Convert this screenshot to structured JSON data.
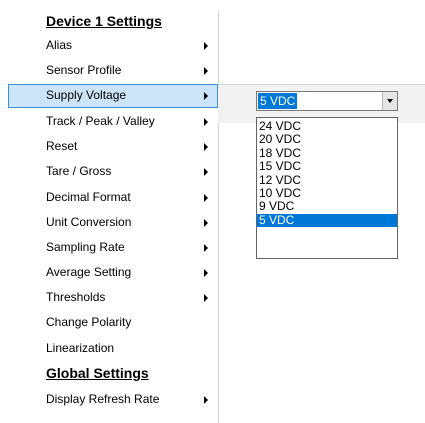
{
  "menu": {
    "items": [
      {
        "label": "Device 1 Settings",
        "kind": "header",
        "arrow": false
      },
      {
        "label": "Alias",
        "kind": "item",
        "arrow": true
      },
      {
        "label": "Sensor Profile",
        "kind": "item",
        "arrow": true
      },
      {
        "label": "Supply Voltage",
        "kind": "item",
        "arrow": true,
        "selected": true
      },
      {
        "label": "Track / Peak / Valley",
        "kind": "item",
        "arrow": true
      },
      {
        "label": "Reset",
        "kind": "item",
        "arrow": true
      },
      {
        "label": "Tare / Gross",
        "kind": "item",
        "arrow": true
      },
      {
        "label": "Decimal Format",
        "kind": "item",
        "arrow": true
      },
      {
        "label": "Unit Conversion",
        "kind": "item",
        "arrow": true
      },
      {
        "label": "Sampling Rate",
        "kind": "item",
        "arrow": true
      },
      {
        "label": "Average Setting",
        "kind": "item",
        "arrow": true
      },
      {
        "label": "Thresholds",
        "kind": "item",
        "arrow": true
      },
      {
        "label": "Change Polarity",
        "kind": "item",
        "arrow": false
      },
      {
        "label": "Linearization",
        "kind": "item",
        "arrow": false
      },
      {
        "label": "Global Settings",
        "kind": "header",
        "arrow": false
      },
      {
        "label": "Display Refresh Rate",
        "kind": "item",
        "arrow": true
      }
    ]
  },
  "supply_voltage": {
    "selected_value": "5 VDC",
    "options": [
      "24 VDC",
      "20 VDC",
      "18 VDC",
      "15 VDC",
      "12 VDC",
      "10 VDC",
      "9 VDC",
      "5 VDC"
    ],
    "highlighted_option": "5 VDC"
  },
  "colors": {
    "selection_blue": "#0078d7",
    "menu_hover_fill": "#cce4f7",
    "menu_hover_border": "#3d8fd8"
  },
  "icons": {
    "submenu_arrow": "chevron-right-icon",
    "dropdown_button": "chevron-down-icon"
  }
}
